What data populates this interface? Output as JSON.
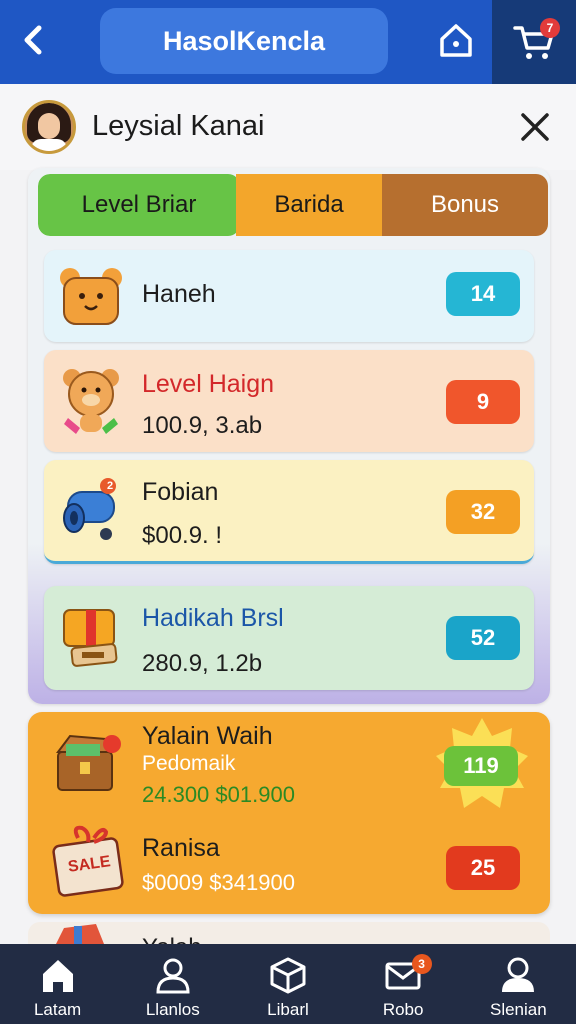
{
  "header": {
    "title": "HasolKencla",
    "cart_badge": "7"
  },
  "user": {
    "name": "Leysial Kanai"
  },
  "tabs": [
    {
      "label": "Level Briar",
      "color": "#67c446"
    },
    {
      "label": "Barida",
      "color": "#f3a62b"
    },
    {
      "label": "Bonus",
      "color": "#b66f2f"
    }
  ],
  "rows": [
    {
      "name": "Haneh",
      "sub": "",
      "value": "14",
      "pill_color": "#25b6d4",
      "icon": "bear-face-icon"
    },
    {
      "name": "Level Haign",
      "sub": "100.9, 3.ab",
      "value": "9",
      "pill_color": "#f0562c",
      "icon": "teddy-bear-icon"
    },
    {
      "name": "Fobian",
      "sub": "$00.9. !",
      "value": "32",
      "pill_color": "#f4a024",
      "icon": "blue-vacuum-icon",
      "icon_badge": "2"
    },
    {
      "name": "Hadikah Brsl",
      "sub": "280.9, 1.2b",
      "value": "52",
      "pill_color": "#1aa4c9",
      "icon": "gift-box-icon"
    }
  ],
  "promo": {
    "item1": {
      "title": "Yalain Waih",
      "subtitle": "Pedomaik",
      "prices": "24.300 $01.900",
      "value": "119",
      "icon": "treasure-chest-icon"
    },
    "item2": {
      "title": "Ranisa",
      "prices": "$0009 $341900",
      "value": "25",
      "icon": "sale-gift-icon",
      "tag": "SALE"
    },
    "item3_partial": "Yalah"
  },
  "nav": [
    {
      "label": "Latam",
      "icon": "home-icon"
    },
    {
      "label": "Llanlos",
      "icon": "user-icon"
    },
    {
      "label": "Libarl",
      "icon": "box-icon"
    },
    {
      "label": "Robo",
      "icon": "mail-icon",
      "badge": "3"
    },
    {
      "label": "Slenian",
      "icon": "profile-icon"
    }
  ]
}
